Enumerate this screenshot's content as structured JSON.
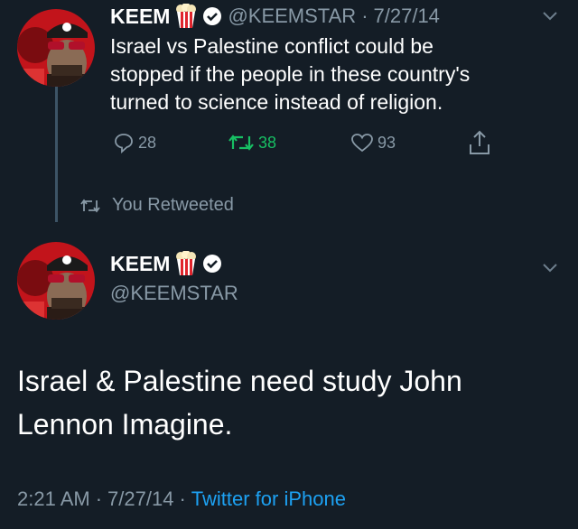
{
  "colors": {
    "background": "#141d26",
    "muted": "#8899a6",
    "retweet": "#17bf63",
    "link": "#1da1f2"
  },
  "quoted_tweet": {
    "name": "KEEM",
    "handle": "@KEEMSTAR",
    "separator": "·",
    "date": "7/27/14",
    "text_lines": [
      "Israel vs Palestine conflict could be",
      "stopped if the people in these country's",
      "turned to science instead of religion."
    ],
    "actions": {
      "replies": "28",
      "retweets": "38",
      "likes": "93"
    }
  },
  "retweet_notice": "You Retweeted",
  "main_tweet": {
    "name": "KEEM",
    "handle": "@KEEMSTAR",
    "text_lines": [
      "Israel & Palestine need study John",
      "Lennon Imagine."
    ],
    "time": "2:21 AM",
    "separator": "·",
    "date": "7/27/14",
    "source": "Twitter for iPhone"
  },
  "icons": [
    "popcorn-icon",
    "verified-badge-icon",
    "chevron-down-icon",
    "reply-icon",
    "retweet-icon",
    "like-icon",
    "share-icon"
  ]
}
